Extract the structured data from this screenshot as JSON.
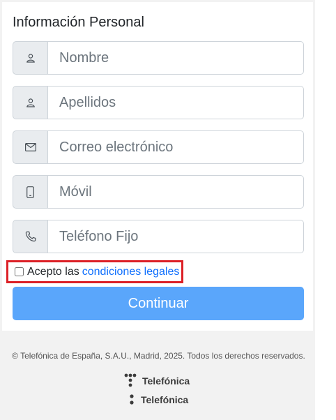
{
  "form": {
    "title": "Información Personal",
    "fields": [
      {
        "placeholder": "Nombre",
        "icon": "user-icon"
      },
      {
        "placeholder": "Apellidos",
        "icon": "user-icon"
      },
      {
        "placeholder": "Correo electrónico",
        "icon": "envelope-icon"
      },
      {
        "placeholder": "Móvil",
        "icon": "mobile-phone-icon"
      },
      {
        "placeholder": "Teléfono Fijo",
        "icon": "telephone-icon"
      }
    ],
    "terms_prefix": "Acepto las",
    "terms_link": "condiciones legales",
    "continue_label": "Continuar"
  },
  "footer": {
    "copyright": "© Telefónica de España, S.A.U., Madrid, 2025. Todos los derechos reservados.",
    "logo_text_1": "Telefónica",
    "logo_text_2": "Telefónica"
  },
  "colors": {
    "accent": "#5aa6fb",
    "link": "#0d6efd",
    "highlight": "#dc2026"
  }
}
